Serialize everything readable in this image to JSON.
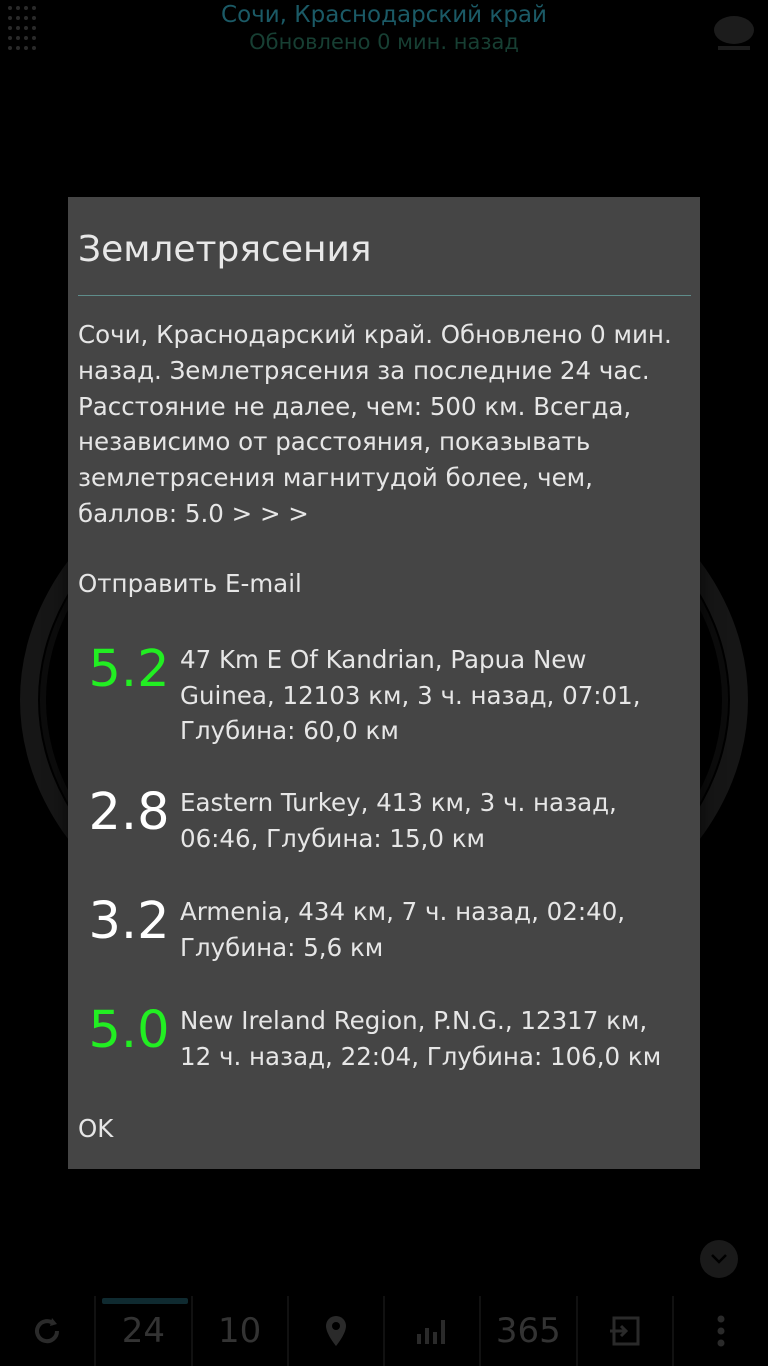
{
  "header": {
    "city": "Сочи, Краснодарский край",
    "updated": "Обновлено 0 мин. назад"
  },
  "bottom_bar": {
    "items": [
      {
        "icon": "refresh-icon",
        "label": ""
      },
      {
        "icon": "",
        "label": "24"
      },
      {
        "icon": "",
        "label": "10"
      },
      {
        "icon": "location-icon",
        "label": ""
      },
      {
        "icon": "trend-icon",
        "label": ""
      },
      {
        "icon": "",
        "label": "365"
      },
      {
        "icon": "exit-icon",
        "label": ""
      },
      {
        "icon": "more-icon",
        "label": ""
      }
    ]
  },
  "dialog": {
    "title": "Землетрясения",
    "message": "Сочи, Краснодарский край. Обновлено 0 мин. назад. Землетрясения за последние 24 час. Расстояние не далее, чем: 500 км. Всегда, независимо от расстояния, показывать землетрясения магнитудой более, чем, баллов: 5.0 > > >",
    "email_label": "Отправить E-mail",
    "quakes": [
      {
        "mag": "5.2",
        "color": "#22ee22",
        "text": "47 Km E Of Kandrian, Papua New Guinea, 12103 км, 3 ч. назад, 07:01, Глубина: 60,0 км"
      },
      {
        "mag": "2.8",
        "color": "#ffffff",
        "text": "Eastern Turkey, 413 км, 3 ч. назад, 06:46, Глубина: 15,0 км"
      },
      {
        "mag": "3.2",
        "color": "#ffffff",
        "text": "Armenia, 434 км, 7 ч. назад, 02:40, Глубина: 5,6 км"
      },
      {
        "mag": "5.0",
        "color": "#22ee22",
        "text": "New Ireland Region, P.N.G., 12317 км, 12 ч. назад, 22:04, Глубина: 106,0 км"
      }
    ],
    "ok_label": "OK"
  },
  "colors": {
    "dialog_bg": "#454545",
    "divider": "#5f8d8b",
    "strong_quake": "#22ee22",
    "normal_quake": "#ffffff"
  }
}
